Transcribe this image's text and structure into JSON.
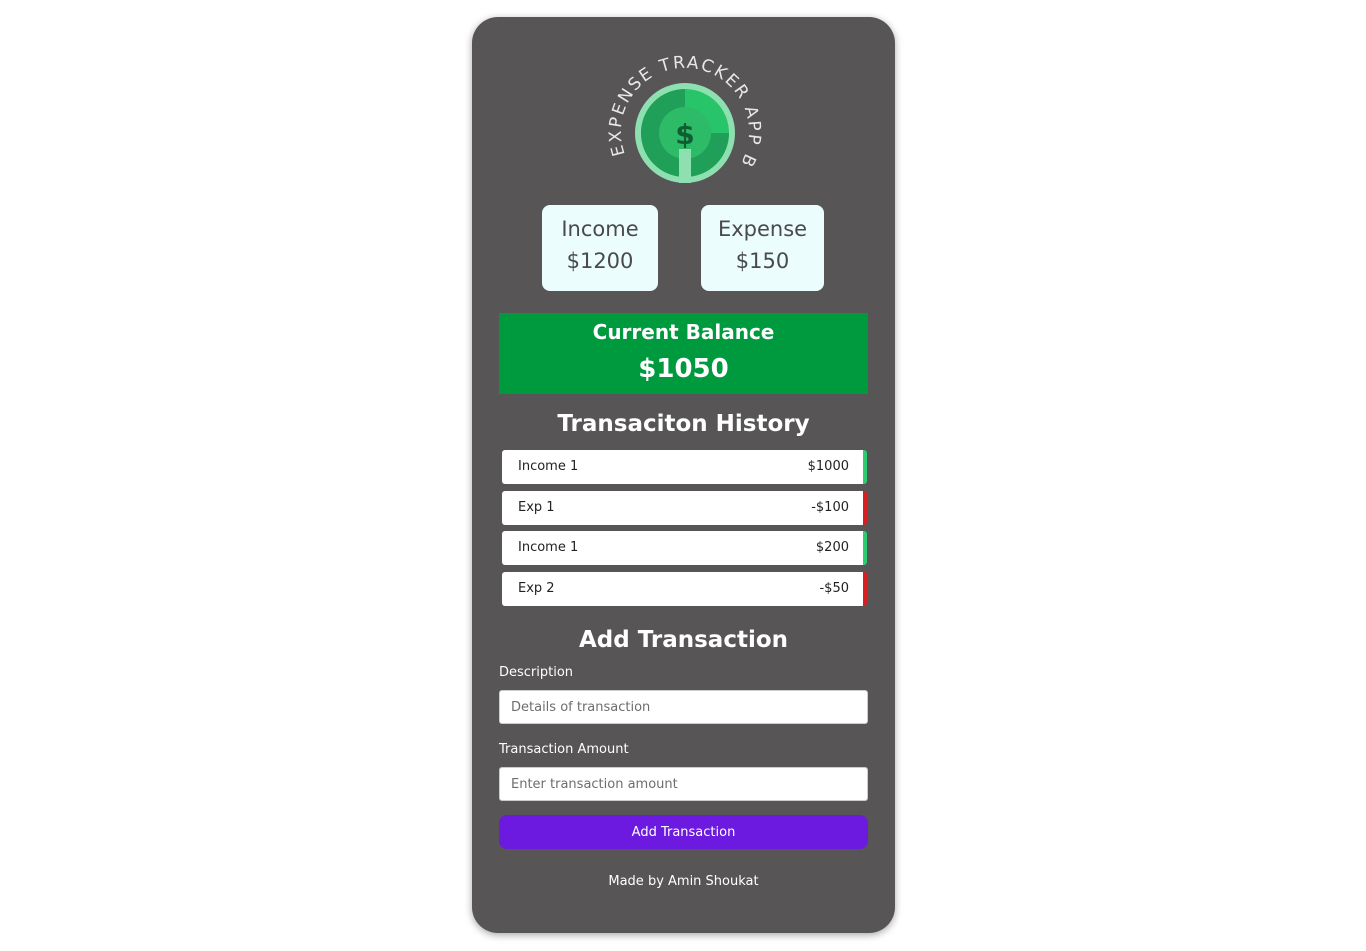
{
  "logo": {
    "ring_text": "EXPENSE TRACKER APP BY AMIN",
    "symbol": "$",
    "colors": {
      "ring_text": "#e8e8e8",
      "outer": "#8fe0b0",
      "inner": "#1f9f57",
      "accent": "#27c46a"
    }
  },
  "summary": {
    "income_label": "Income",
    "income_value": "$1200",
    "expense_label": "Expense",
    "expense_value": "$150"
  },
  "balance": {
    "label": "Current Balance",
    "value": "$1050"
  },
  "history": {
    "title": "Transaciton History",
    "items": [
      {
        "name": "Income 1",
        "amount": "$1000",
        "type": "plus"
      },
      {
        "name": "Exp 1",
        "amount": "-$100",
        "type": "minus"
      },
      {
        "name": "Income 1",
        "amount": "$200",
        "type": "plus"
      },
      {
        "name": "Exp 2",
        "amount": "-$50",
        "type": "minus"
      }
    ]
  },
  "form": {
    "title": "Add Transaction",
    "description_label": "Description",
    "description_placeholder": "Details of transaction",
    "description_value": "",
    "amount_label": "Transaction Amount",
    "amount_placeholder": "Enter transaction amount",
    "amount_value": "",
    "submit_label": "Add Transaction"
  },
  "footer": {
    "text": "Made by Amin Shoukat"
  },
  "colors": {
    "panel_bg": "#575556",
    "card_bg": "#ecfdfd",
    "balance_bg": "#009a3e",
    "plus_accent": "#2ecc71",
    "minus_accent": "#d81e1e",
    "button_bg": "#6c1ae0"
  }
}
